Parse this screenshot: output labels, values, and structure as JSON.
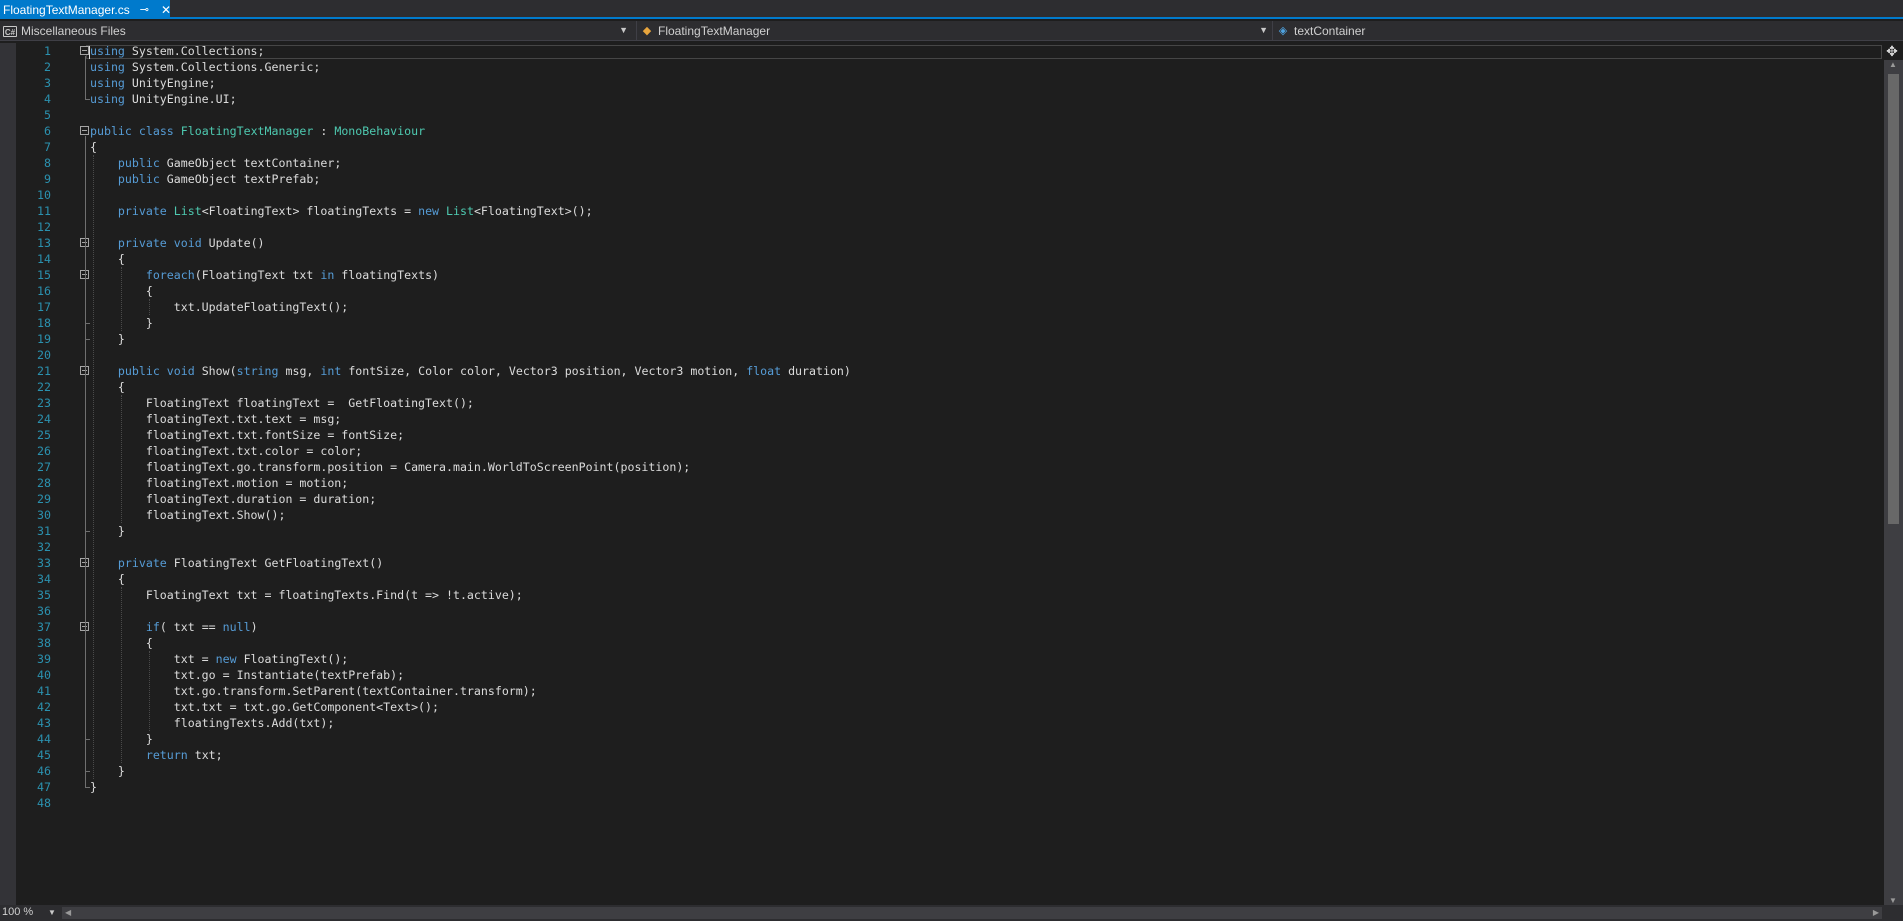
{
  "tab": {
    "title": "FloatingTextManager.cs",
    "pin_icon": "pin-icon",
    "close_icon": "close-icon"
  },
  "nav": {
    "project": "Miscellaneous Files",
    "class": "FloatingTextManager",
    "member": "textContainer"
  },
  "editor": {
    "zoom": "100 %",
    "lines": [
      "using System.Collections;",
      "using System.Collections.Generic;",
      "using UnityEngine;",
      "using UnityEngine.UI;",
      "",
      "public class FloatingTextManager : MonoBehaviour",
      "{",
      "    public GameObject textContainer;",
      "    public GameObject textPrefab;",
      "",
      "    private List<FloatingText> floatingTexts = new List<FloatingText>();",
      "",
      "    private void Update()",
      "    {",
      "        foreach(FloatingText txt in floatingTexts)",
      "        {",
      "            txt.UpdateFloatingText();",
      "        }",
      "    }",
      "",
      "    public void Show(string msg, int fontSize, Color color, Vector3 position, Vector3 motion, float duration)",
      "    {",
      "        FloatingText floatingText =  GetFloatingText();",
      "        floatingText.txt.text = msg;",
      "        floatingText.txt.fontSize = fontSize;",
      "        floatingText.txt.color = color;",
      "        floatingText.go.transform.position = Camera.main.WorldToScreenPoint(position);",
      "        floatingText.motion = motion;",
      "        floatingText.duration = duration;",
      "        floatingText.Show();",
      "    }",
      "",
      "    private FloatingText GetFloatingText()",
      "    {",
      "        FloatingText txt = floatingTexts.Find(t => !t.active);",
      "",
      "        if( txt == null)",
      "        {",
      "            txt = new FloatingText();",
      "            txt.go = Instantiate(textPrefab);",
      "            txt.go.transform.SetParent(textContainer.transform);",
      "            txt.txt = txt.go.GetComponent<Text>();",
      "            floatingTexts.Add(txt);",
      "        }",
      "        return txt;",
      "    }",
      "}",
      ""
    ],
    "fold_lines": [
      1,
      6,
      13,
      15,
      21,
      33,
      37
    ]
  },
  "colors": {
    "keyword": "#569cd6",
    "type": "#4ec9b0",
    "text": "#dcdcdc",
    "line_number": "#2b91af",
    "accent": "#007acc"
  }
}
